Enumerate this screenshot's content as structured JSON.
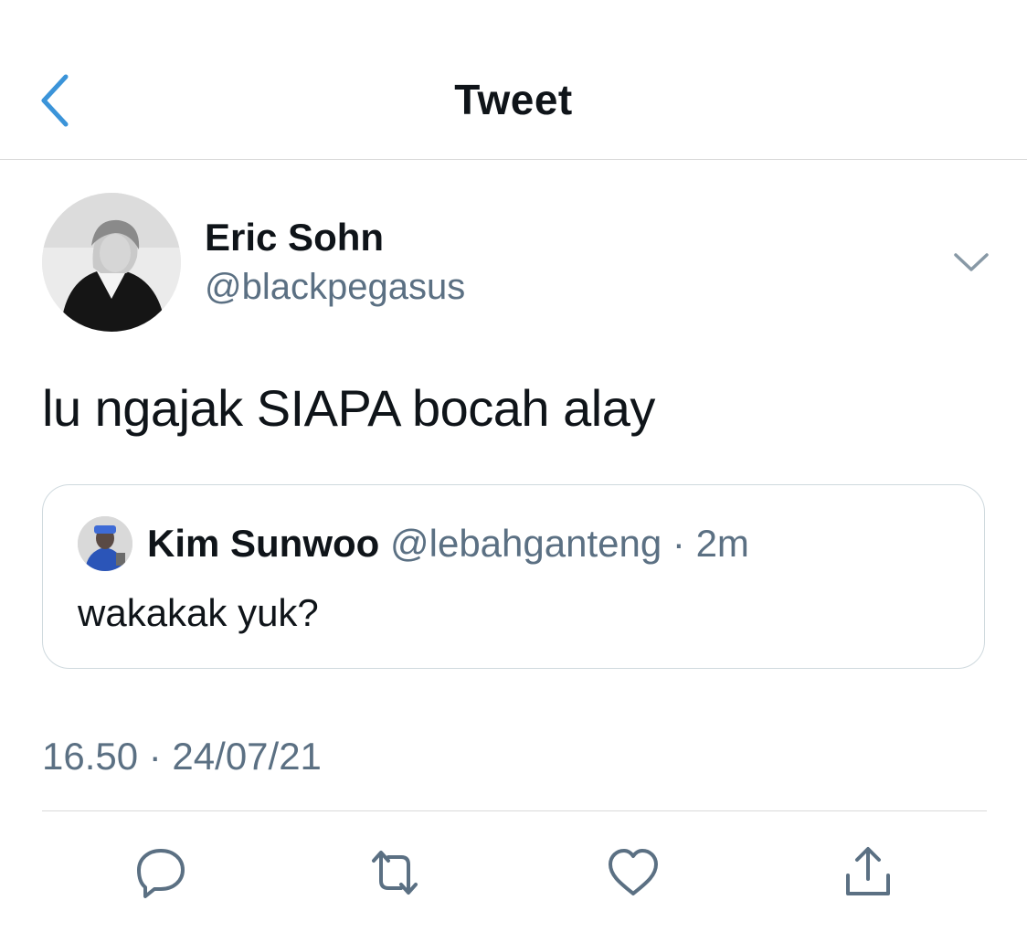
{
  "header": {
    "title": "Tweet",
    "back_icon": "chevron-left-icon",
    "accent_color": "#3b94d9"
  },
  "tweet": {
    "author_name": "Eric Sohn",
    "author_handle": "@blackpegasus",
    "text": "lu ngajak SIAPA bocah alay",
    "menu_icon": "chevron-down-icon",
    "timestamp": "16.50 · 24/07/21"
  },
  "quote": {
    "author_name": "Kim Sunwoo",
    "author_handle": "@lebahganteng",
    "separator": "·",
    "time": "2m",
    "text": "wakakak yuk?"
  },
  "actions": [
    {
      "name": "reply",
      "icon": "reply-icon"
    },
    {
      "name": "retweet",
      "icon": "retweet-icon"
    },
    {
      "name": "like",
      "icon": "heart-icon"
    },
    {
      "name": "share",
      "icon": "share-icon"
    }
  ],
  "colors": {
    "text": "#0f1419",
    "secondary": "#5b7083",
    "border": "#cfd9de"
  }
}
